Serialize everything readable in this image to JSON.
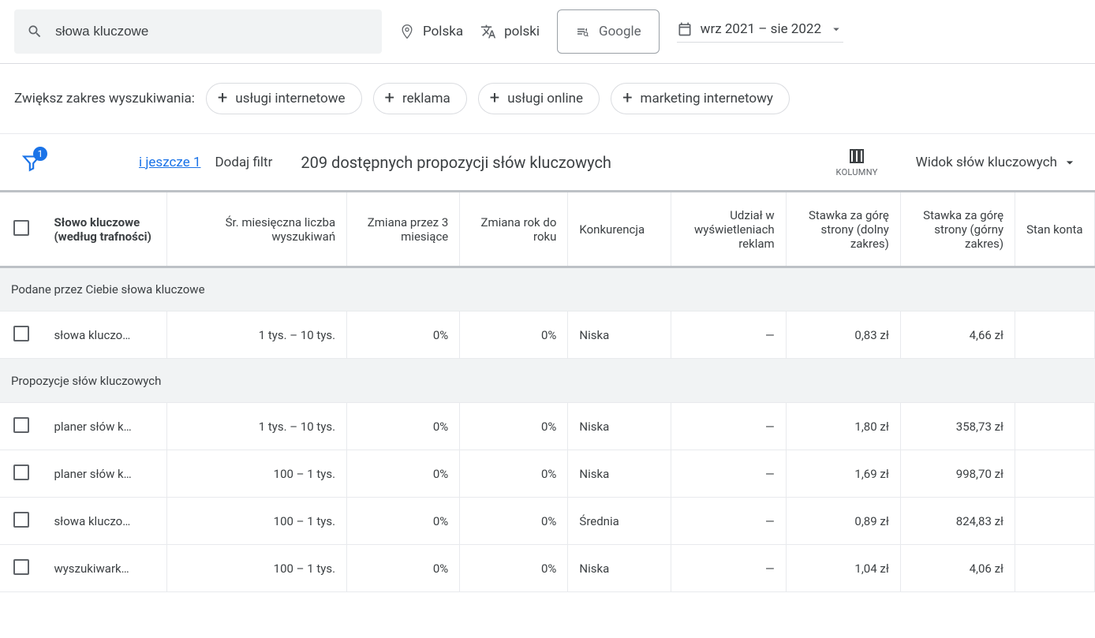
{
  "search": {
    "value": "słowa kluczowe"
  },
  "location": "Polska",
  "language": "polski",
  "network": "Google",
  "date_range": "wrz 2021 – sie 2022",
  "broaden": {
    "label": "Zwiększ zakres wyszukiwania:",
    "chips": [
      "usługi internetowe",
      "reklama",
      "usługi online",
      "marketing internetowy"
    ]
  },
  "filters": {
    "badge": "1",
    "more": "i jeszcze 1",
    "add": "Dodaj filtr",
    "available": "209 dostępnych propozycji słów kluczowych",
    "columns": "KOLUMNY",
    "view": "Widok słów kluczowych"
  },
  "columns": {
    "keyword": "Słowo kluczowe (według trafności)",
    "avg_search": "Śr. miesięczna liczba wyszukiwań",
    "change_3m": "Zmiana przez 3 miesiące",
    "change_yoy": "Zmiana rok do roku",
    "competition": "Konkurencja",
    "impression_share": "Udział w wyświetleniach reklam",
    "bid_low": "Stawka za górę strony (dolny zakres)",
    "bid_high": "Stawka za górę strony (górny zakres)",
    "account_status": "Stan konta"
  },
  "sections": {
    "provided": "Podane przez Ciebie słowa kluczowe",
    "suggestions": "Propozycje słów kluczowych"
  },
  "rows_provided": [
    {
      "kw": "słowa kluczo…",
      "avg": "1 tys. – 10 tys.",
      "c3m": "0%",
      "cy": "0%",
      "comp": "Niska",
      "share": "—",
      "low": "0,83 zł",
      "high": "4,66 zł"
    }
  ],
  "rows_suggested": [
    {
      "kw": "planer słów k…",
      "avg": "1 tys. – 10 tys.",
      "c3m": "0%",
      "cy": "0%",
      "comp": "Niska",
      "share": "—",
      "low": "1,80 zł",
      "high": "358,73 zł"
    },
    {
      "kw": "planer słów k…",
      "avg": "100 – 1 tys.",
      "c3m": "0%",
      "cy": "0%",
      "comp": "Niska",
      "share": "—",
      "low": "1,69 zł",
      "high": "998,70 zł"
    },
    {
      "kw": "słowa kluczo…",
      "avg": "100 – 1 tys.",
      "c3m": "0%",
      "cy": "0%",
      "comp": "Średnia",
      "share": "—",
      "low": "0,89 zł",
      "high": "824,83 zł"
    },
    {
      "kw": "wyszukiwark…",
      "avg": "100 – 1 tys.",
      "c3m": "0%",
      "cy": "0%",
      "comp": "Niska",
      "share": "—",
      "low": "1,04 zł",
      "high": "4,06 zł"
    }
  ]
}
